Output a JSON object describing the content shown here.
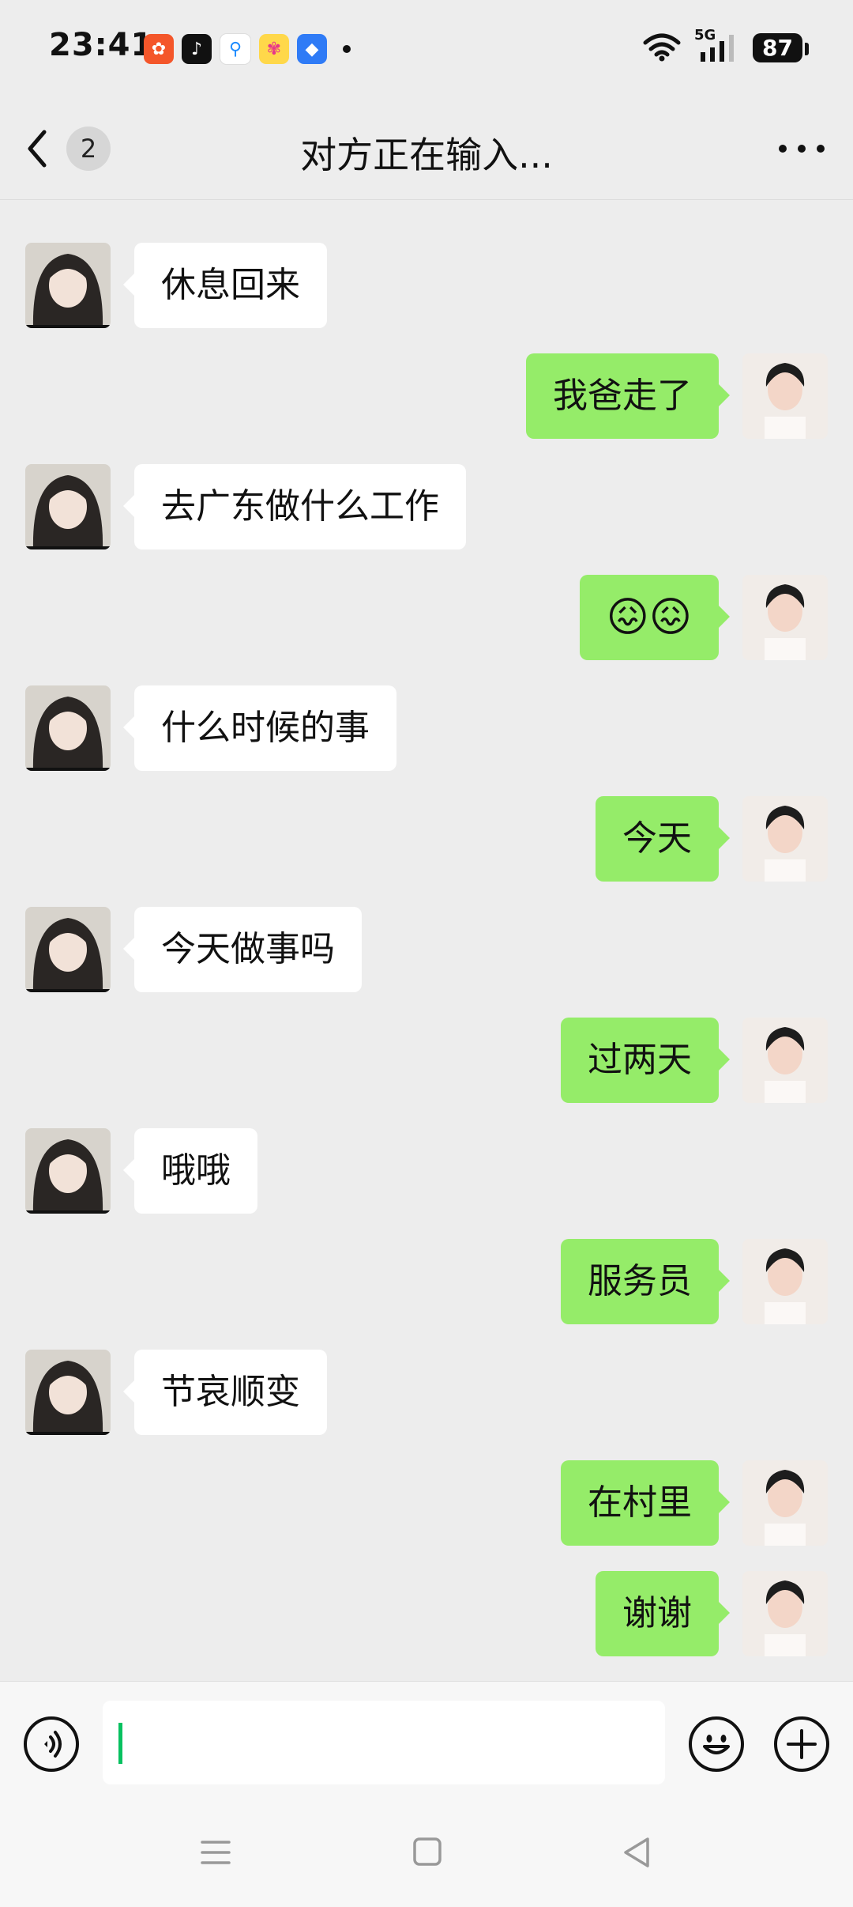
{
  "status_bar": {
    "time": "23:41",
    "network": "5G",
    "battery": "87"
  },
  "nav": {
    "unread_count": "2",
    "title": "对方正在输入..."
  },
  "messages": [
    {
      "side": "in",
      "text": "休息回来"
    },
    {
      "side": "out",
      "text": "我爸走了"
    },
    {
      "side": "in",
      "text": "去广东做什么工作"
    },
    {
      "side": "out",
      "text": "😖😖"
    },
    {
      "side": "in",
      "text": "什么时候的事"
    },
    {
      "side": "out",
      "text": "今天"
    },
    {
      "side": "in",
      "text": "今天做事吗"
    },
    {
      "side": "out",
      "text": "过两天"
    },
    {
      "side": "in",
      "text": "哦哦"
    },
    {
      "side": "out",
      "text": "服务员"
    },
    {
      "side": "in",
      "text": "节哀顺变"
    },
    {
      "side": "out",
      "text": "在村里"
    },
    {
      "side": "out",
      "text": "谢谢"
    }
  ],
  "input": {
    "value": ""
  },
  "colors": {
    "background": "#ededed",
    "outgoing_bubble": "#95ec69",
    "incoming_bubble": "#ffffff",
    "caret": "#07c160"
  }
}
